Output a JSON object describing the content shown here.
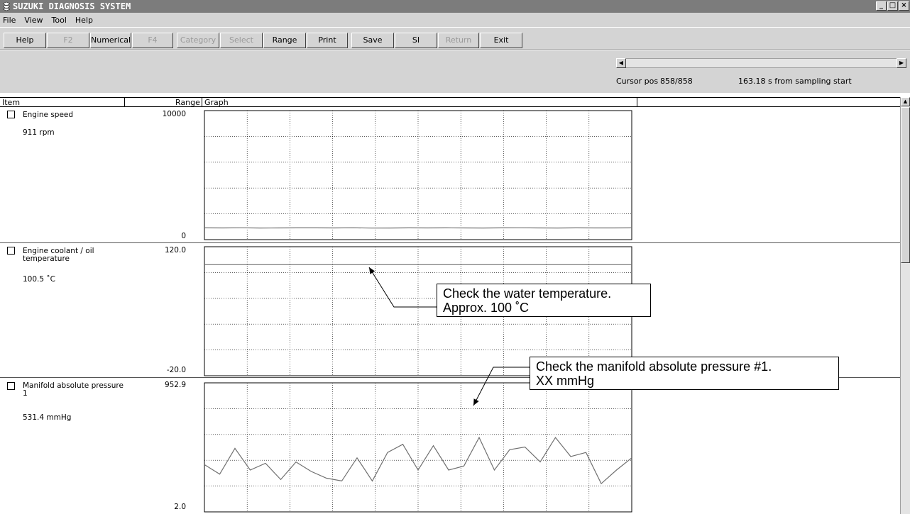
{
  "window": {
    "title": "SUZUKI DIAGNOSIS SYSTEM",
    "minimize": "_",
    "maximize": "□",
    "close": "×"
  },
  "menu": {
    "file": "File",
    "view": "View",
    "tool": "Tool",
    "help": "Help"
  },
  "toolbar": {
    "help": "Help",
    "f2": "F2",
    "numerical": "Numerical",
    "f4": "F4",
    "category": "Category",
    "select": "Select",
    "range": "Range",
    "print": "Print",
    "save": "Save",
    "si": "SI",
    "return": "Return",
    "exit": "Exit"
  },
  "status": {
    "cursor_label": "Cursor pos",
    "cursor_value": "858/858",
    "elapsed": "163.18 s from sampling start"
  },
  "columns": {
    "item": "Item",
    "range": "Range",
    "graph": "Graph"
  },
  "rows": [
    {
      "name": "Engine speed",
      "value": "911 rpm",
      "range_max": "10000",
      "range_min": "0"
    },
    {
      "name": "Engine coolant / oil temperature",
      "value": "100.5 ˚C",
      "range_max": "120.0",
      "range_min": "-20.0"
    },
    {
      "name": "Manifold absolute pressure 1",
      "value": "531.4 mmHg",
      "range_max": "952.9",
      "range_min": "2.0"
    }
  ],
  "callouts": {
    "water_line1": "Check the water temperature.",
    "water_line2": "Approx. 100 ˚C",
    "map_line1": "Check the manifold absolute pressure #1.",
    "map_line2": "XX mmHg"
  },
  "chart_data": [
    {
      "type": "line",
      "series": [
        {
          "values": [
            911,
            905,
            915,
            900,
            908,
            912,
            910,
            905,
            918,
            895,
            900,
            910,
            905,
            912,
            908,
            900,
            910,
            915,
            905,
            902,
            911,
            905,
            908,
            911
          ]
        }
      ],
      "ylim": [
        0,
        10000
      ],
      "grid": true,
      "color": "#707070"
    },
    {
      "type": "line",
      "series": [
        {
          "values": [
            100.5,
            100.5
          ]
        }
      ],
      "ylim": [
        -20,
        120
      ],
      "grid": true,
      "color": "#707070"
    },
    {
      "type": "line",
      "series": [
        {
          "values": [
            350,
            280,
            470,
            310,
            360,
            240,
            370,
            300,
            250,
            230,
            400,
            230,
            440,
            500,
            310,
            490,
            310,
            340,
            550,
            310,
            460,
            480,
            370,
            550,
            410,
            440,
            210,
            310,
            400
          ]
        }
      ],
      "ylim": [
        2.0,
        952.9
      ],
      "grid": true,
      "color": "#707070"
    }
  ]
}
